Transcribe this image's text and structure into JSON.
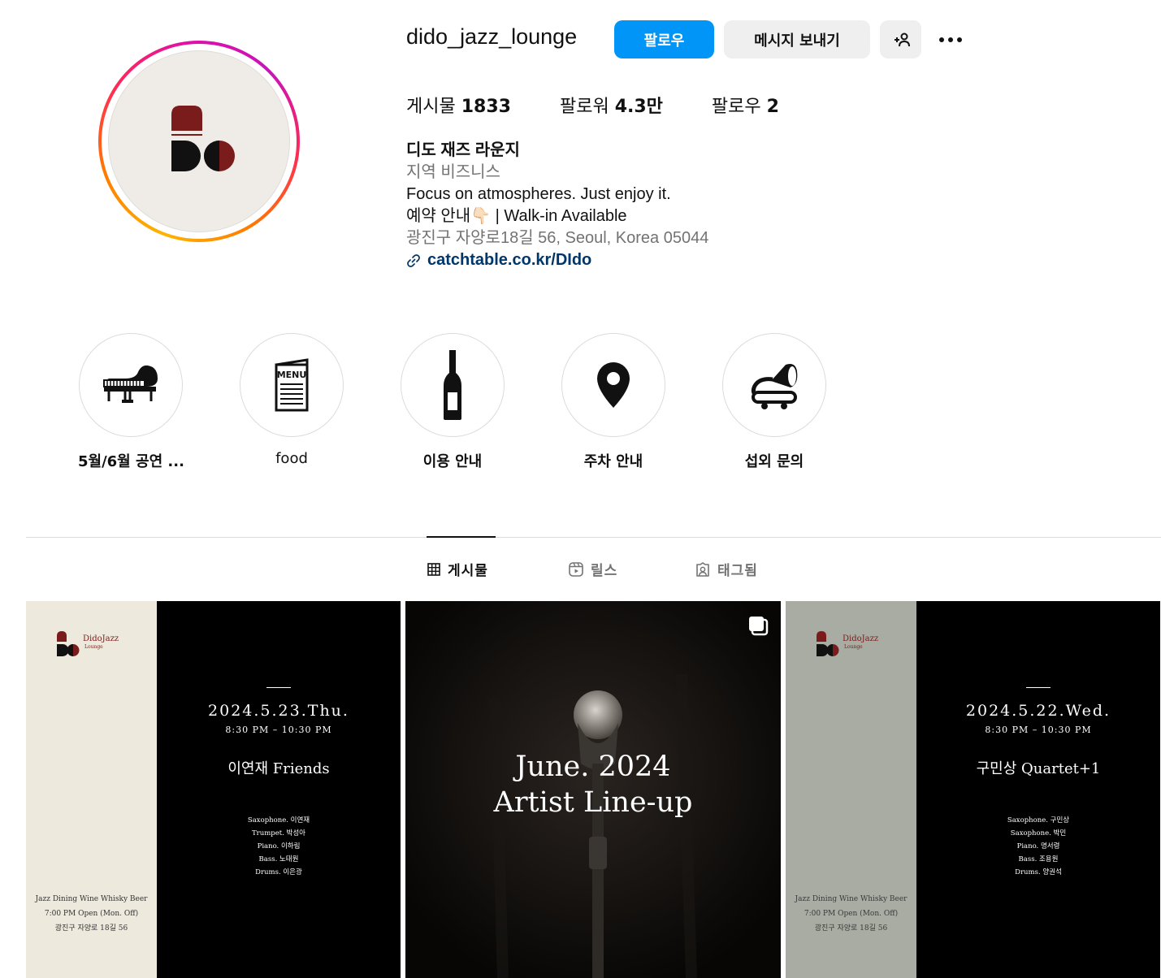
{
  "profile": {
    "username": "dido_jazz_lounge",
    "follow_label": "팔로우",
    "message_label": "메시지 보내기",
    "add_user_label": "+",
    "more_icon": "more-horizontal-icon"
  },
  "stats": {
    "posts_label": "게시물",
    "posts_value": "1833",
    "followers_label": "팔로워",
    "followers_value": "4.3만",
    "following_label": "팔로우",
    "following_value": "2"
  },
  "bio": {
    "name": "디도 재즈 라운지",
    "category": "지역 비즈니스",
    "line1": "Focus on atmospheres. Just enjoy it.",
    "line2": "예약 안내👇🏻 | Walk-in Available",
    "address": "광진구 자양로18길 56, Seoul, Korea 05044",
    "link": "catchtable.co.kr/DIdo"
  },
  "highlights": [
    {
      "label": "5월/6월 공연 ...",
      "icon": "grand-piano-icon"
    },
    {
      "label": "food",
      "icon": "menu-icon"
    },
    {
      "label": "이용 안내",
      "icon": "wine-bottle-icon"
    },
    {
      "label": "주차 안내",
      "icon": "location-pin-icon"
    },
    {
      "label": "섭외 문의",
      "icon": "gramophone-icon"
    }
  ],
  "tabs": [
    {
      "label": "게시물",
      "icon": "grid-icon",
      "active": true
    },
    {
      "label": "릴스",
      "icon": "reels-icon",
      "active": false
    },
    {
      "label": "태그됨",
      "icon": "tagged-icon",
      "active": false
    }
  ],
  "posts": [
    {
      "brand_top": "DidoJazz",
      "brand_sub": "Lounge",
      "footer1": "Jazz   Dining   Wine   Whisky   Beer",
      "footer2": "7:00 PM Open (Mon. Off)",
      "footer3": "광진구 자양로 18길 56",
      "date": "2024.5.23.Thu.",
      "time": "8:30 PM  –  10:30 PM",
      "band": "이연재 Friends",
      "members": [
        "Saxophone. 이연재",
        "Trumpet. 박성아",
        "Piano. 이하림",
        "Bass. 노태원",
        "Drums. 이은광"
      ],
      "left_color": "#ede9dc"
    },
    {
      "title1": "June. 2024",
      "title2": "Artist Line-up",
      "multi_icon": "carousel-icon"
    },
    {
      "brand_top": "DidoJazz",
      "brand_sub": "Lounge",
      "footer1": "Jazz   Dining   Wine   Whisky   Beer",
      "footer2": "7:00 PM Open (Mon. Off)",
      "footer3": "광진구 자양로 18길 56",
      "date": "2024.5.22.Wed.",
      "time": "8:30 PM  –  10:30 PM",
      "band": "구민상 Quartet+1",
      "members": [
        "Saxophone. 구민상",
        "Saxophone. 박민",
        "Piano. 명서령",
        "Bass. 조용원",
        "Drums. 양권석"
      ],
      "left_color": "#a8aca2"
    }
  ],
  "colors": {
    "accent": "#0095f6",
    "brand_red": "#7a1c1c"
  }
}
